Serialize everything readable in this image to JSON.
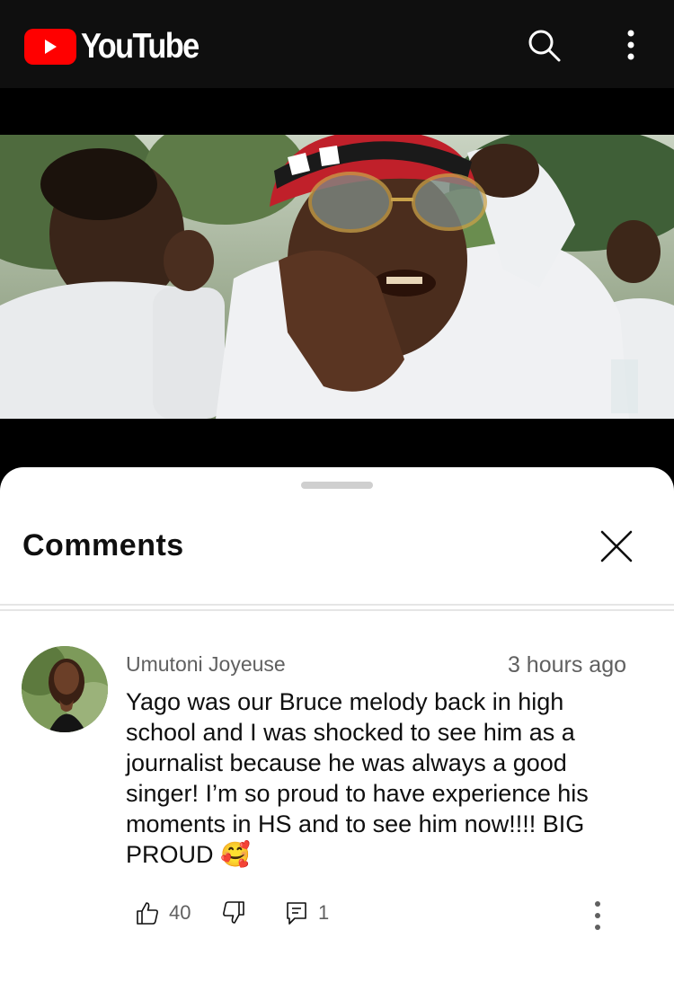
{
  "header": {
    "brand": "YouTube",
    "icons": {
      "logo": "youtube-play-logo",
      "search": "search-icon",
      "more": "more-vert-icon"
    }
  },
  "video": {
    "description": "music video frame with man in white hoodie, striped beanie and gold glasses"
  },
  "comments_sheet": {
    "title": "Comments",
    "close_icon": "close-icon",
    "comment": {
      "author": "Umutoni Joyeuse",
      "time": "3 hours ago",
      "text": "Yago was our Bruce melody back in high\nschool and I was shocked to see him as a\njournalist because he was always a good\nsinger! I’m so proud to have experience his\nmoments in HS  and to see him now!!!! BIG\nPROUD 🥰",
      "likes": "40",
      "replies": "1"
    }
  },
  "colors": {
    "header_bg": "#0f0f0f",
    "brand_red": "#ff0000",
    "sheet_bg": "#ffffff",
    "secondary_text": "#606060"
  }
}
